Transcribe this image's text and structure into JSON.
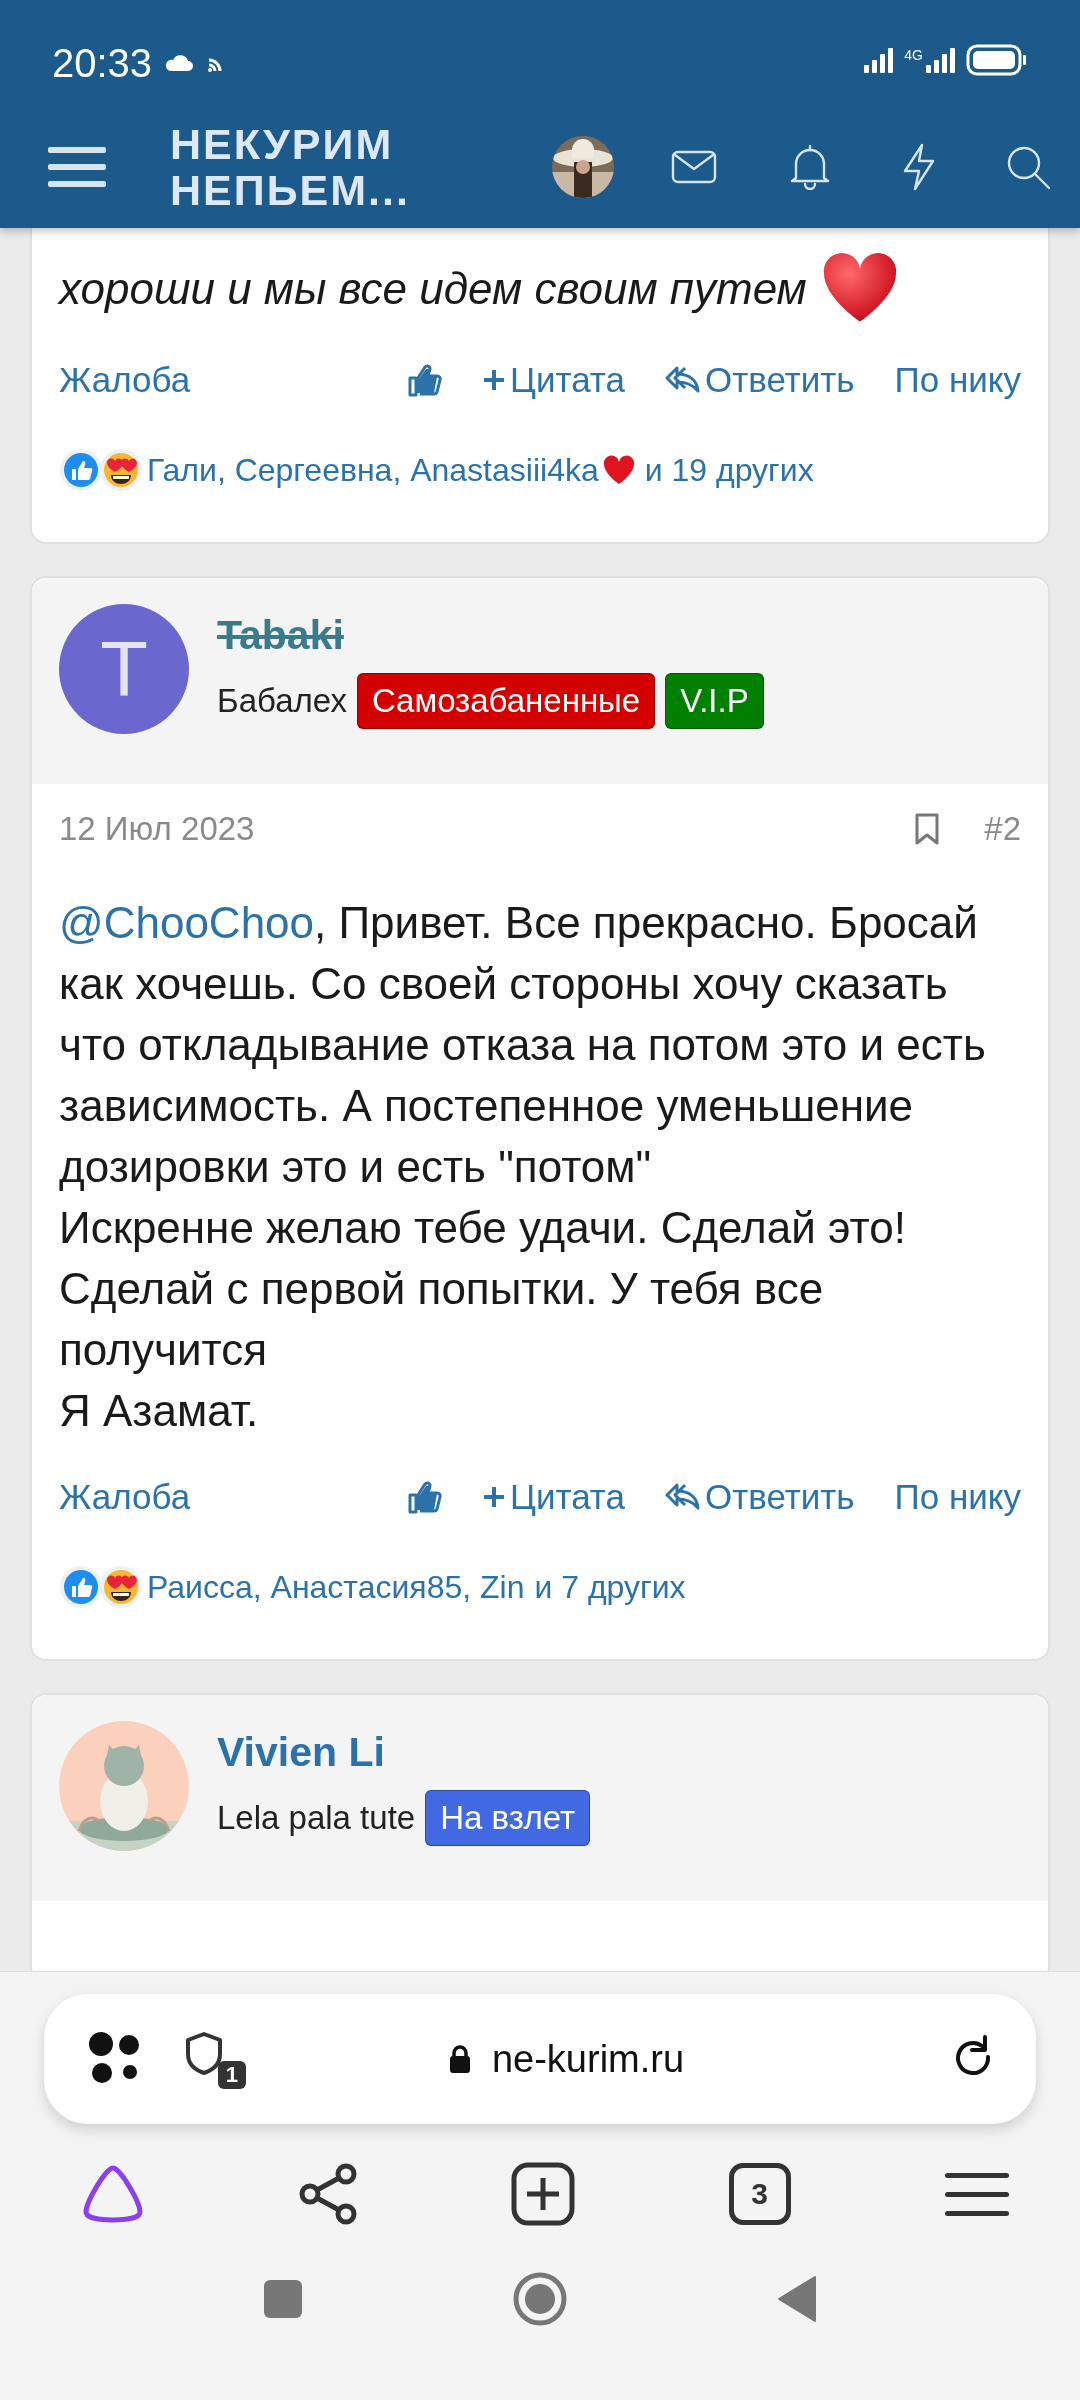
{
  "status_bar": {
    "time": "20:33",
    "network": "4G"
  },
  "header": {
    "logo": [
      "НЕКУРИМ",
      "НЕПЬЕМ..."
    ]
  },
  "posts": [
    {
      "kind": "tail",
      "body": [
        {
          "text": "хороши и мы все идем своим путем",
          "italic": true,
          "heart": true
        }
      ],
      "actions": [
        {
          "kind": "link",
          "label": "Жалоба"
        },
        {
          "kind": "like"
        },
        {
          "kind": "quote",
          "label": "Цитата"
        },
        {
          "kind": "reply",
          "label": "Ответить"
        },
        {
          "kind": "link",
          "label": "По нику"
        }
      ],
      "reactions": {
        "names": "Гали, Сергеевна, Anastasiii4ka",
        "heart": true,
        "more": "и 19 других"
      }
    },
    {
      "kind": "full",
      "author": {
        "avatar": {
          "kind": "letter",
          "initial": "T",
          "color": "#6a67ce"
        },
        "name": "Tabaki",
        "struck": true,
        "title": "Бабалех",
        "badges": [
          {
            "label": "Самозабаненные",
            "color": "#d40000"
          },
          {
            "label": "V.I.P",
            "color": "#007f00"
          }
        ]
      },
      "date": "12 Июл 2023",
      "number": "#2",
      "body": [
        {
          "mention": "@ChooChoo",
          "text": ", Привет. Все прекрасно. Бросай как хочешь. Со своей стороны хочу сказать что откладывание отказа на потом это и есть зависимость. А постепенное уменьшение дозировки это и есть \"потом\"",
          "italic": false,
          "heart": false
        },
        {
          "text": "Искренне желаю тебе удачи. Сделай это!",
          "italic": false,
          "heart": false
        },
        {
          "text": "Сделай с первой попытки. У тебя все получится",
          "italic": false,
          "heart": false
        },
        {
          "text": "Я Азамат.",
          "italic": false,
          "heart": false
        }
      ],
      "actions": [
        {
          "kind": "link",
          "label": "Жалоба"
        },
        {
          "kind": "like"
        },
        {
          "kind": "quote",
          "label": "Цитата"
        },
        {
          "kind": "reply",
          "label": "Ответить"
        },
        {
          "kind": "link",
          "label": "По нику"
        }
      ],
      "reactions": {
        "names": "Раисса, Анастасия85, Zin",
        "heart": false,
        "more": "и 7 других"
      }
    },
    {
      "kind": "partial",
      "author": {
        "name": "Vivien Li",
        "struck": false,
        "title": "Lela pala tute",
        "badges": [
          {
            "label": "На взлет",
            "color": "#4169e1"
          }
        ]
      }
    }
  ],
  "browser": {
    "url": "ne-kurim.ru",
    "shield_count": "1",
    "tab_count": "3"
  }
}
